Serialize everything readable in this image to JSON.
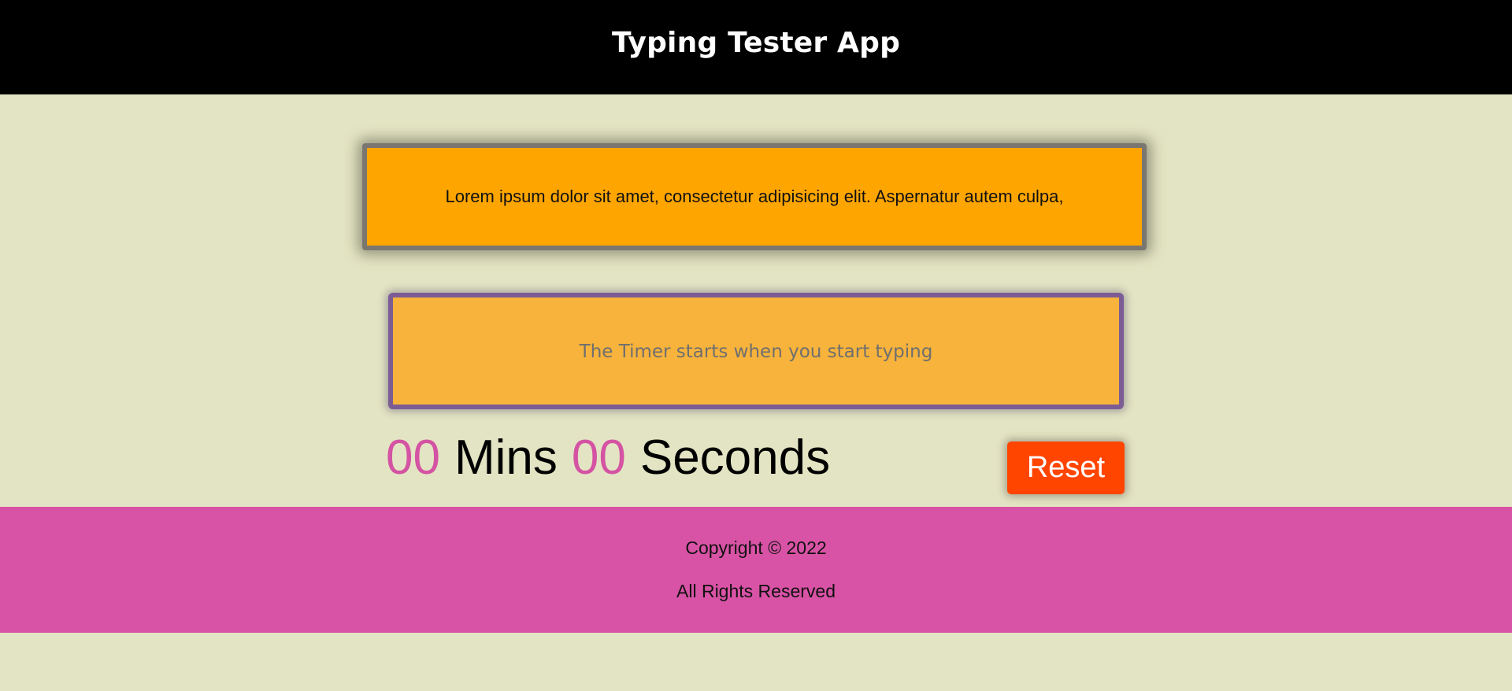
{
  "header": {
    "title": "Typing Tester App"
  },
  "quote": {
    "text": "Lorem ipsum dolor sit amet, consectetur adipisicing elit. Aspernatur autem culpa,"
  },
  "typing_area": {
    "value": "",
    "placeholder": "The Timer starts when you start typing"
  },
  "timer": {
    "minutes": "00",
    "minutes_label": "Mins",
    "seconds": "00",
    "seconds_label": "Seconds"
  },
  "controls": {
    "reset_label": "Reset"
  },
  "footer": {
    "copyright": "Copyright © 2022",
    "rights": "All Rights Reserved"
  },
  "colors": {
    "page_background": "#e3e4c3",
    "header_background": "#000000",
    "quote_background": "#ffa500",
    "typing_area_background": "#f7b33b",
    "typing_area_border": "#7b5c94",
    "timer_number": "#d453a3",
    "reset_button": "#ff4500",
    "footer_background": "#d853a5"
  }
}
